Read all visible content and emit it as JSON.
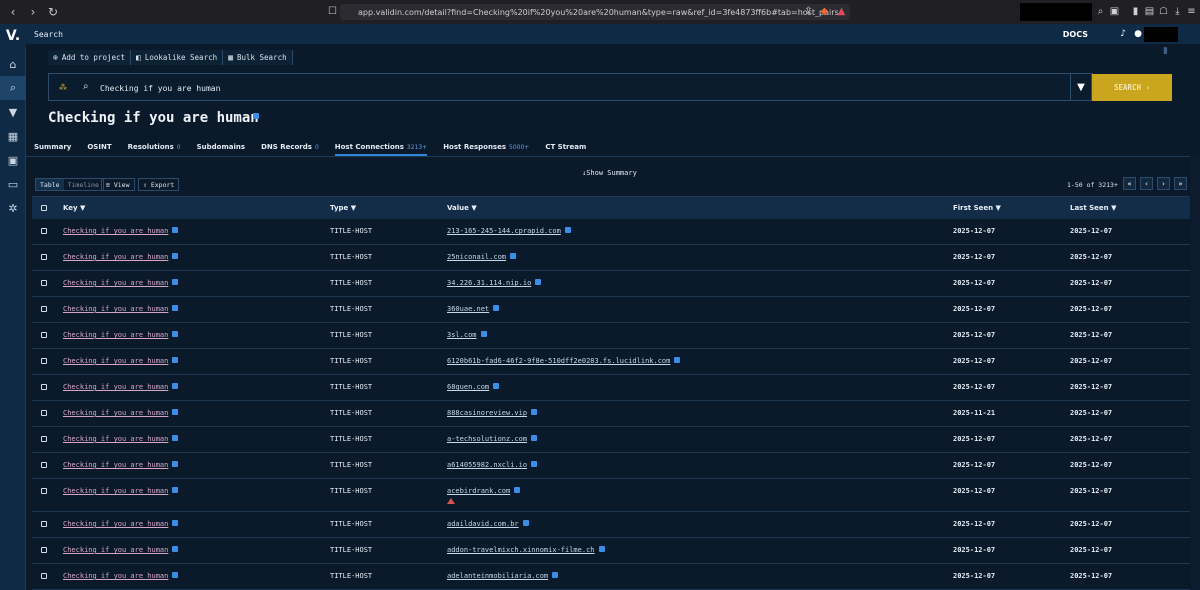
{
  "browser": {
    "url": "app.validin.com/detail?find=Checking%20if%20you%20are%20human&type=raw&ref_id=3fe4873ff6b#tab=host_pairs"
  },
  "app": {
    "logo": "V.",
    "section_title": "Search",
    "docs_label": "DOCS"
  },
  "toolbar": {
    "add_project": "Add to project",
    "lookalike": "Lookalike Search",
    "bulk": "Bulk Search"
  },
  "search": {
    "query": "Checking if you are human",
    "button_label": "SEARCH ›"
  },
  "page_title": "Checking if you are human",
  "tabs": [
    {
      "label": "Summary",
      "badge": ""
    },
    {
      "label": "OSINT",
      "badge": ""
    },
    {
      "label": "Resolutions",
      "badge": "0"
    },
    {
      "label": "Subdomains",
      "badge": ""
    },
    {
      "label": "DNS Records",
      "badge": "0"
    },
    {
      "label": "Host Connections",
      "badge": "3213+"
    },
    {
      "label": "Host Responses",
      "badge": "5000+"
    },
    {
      "label": "CT Stream",
      "badge": ""
    }
  ],
  "summary_toggle": "↓Show Summary",
  "controls": {
    "table": "Table",
    "timeline": "Timeline",
    "view": "View",
    "export": "Export",
    "pagination": "1-50 of 3213+"
  },
  "table": {
    "headers": {
      "key": "Key",
      "type": "Type",
      "value": "Value",
      "first_seen": "First Seen",
      "last_seen": "Last Seen"
    },
    "rows": [
      {
        "key": "Checking if you are human",
        "type": "TITLE-HOST",
        "value": "213-165-245-144.cprapid.com",
        "first": "2025-12-07",
        "last": "2025-12-07"
      },
      {
        "key": "Checking if you are human",
        "type": "TITLE-HOST",
        "value": "25niconail.com",
        "first": "2025-12-07",
        "last": "2025-12-07"
      },
      {
        "key": "Checking if you are human",
        "type": "TITLE-HOST",
        "value": "34.226.31.114.nip.io",
        "first": "2025-12-07",
        "last": "2025-12-07"
      },
      {
        "key": "Checking if you are human",
        "type": "TITLE-HOST",
        "value": "360uae.net",
        "first": "2025-12-07",
        "last": "2025-12-07"
      },
      {
        "key": "Checking if you are human",
        "type": "TITLE-HOST",
        "value": "3sl.com",
        "first": "2025-12-07",
        "last": "2025-12-07"
      },
      {
        "key": "Checking if you are human",
        "type": "TITLE-HOST",
        "value": "6120b61b-fad6-46f2-9f8e-510dff2e0283.fs.lucidlink.com",
        "first": "2025-12-07",
        "last": "2025-12-07"
      },
      {
        "key": "Checking if you are human",
        "type": "TITLE-HOST",
        "value": "68quen.com",
        "first": "2025-12-07",
        "last": "2025-12-07"
      },
      {
        "key": "Checking if you are human",
        "type": "TITLE-HOST",
        "value": "888casinoreview.vip",
        "first": "2025-11-21",
        "last": "2025-12-07"
      },
      {
        "key": "Checking if you are human",
        "type": "TITLE-HOST",
        "value": "a-techsolutionz.com",
        "first": "2025-12-07",
        "last": "2025-12-07"
      },
      {
        "key": "Checking if you are human",
        "type": "TITLE-HOST",
        "value": "a614055982.nxcli.io",
        "first": "2025-12-07",
        "last": "2025-12-07"
      },
      {
        "key": "Checking if you are human",
        "type": "TITLE-HOST",
        "value": "acebirdrank.com",
        "first": "2025-12-07",
        "last": "2025-12-07",
        "warning": true
      },
      {
        "key": "Checking if you are human",
        "type": "TITLE-HOST",
        "value": "adaildavid.com.br",
        "first": "2025-12-07",
        "last": "2025-12-07"
      },
      {
        "key": "Checking if you are human",
        "type": "TITLE-HOST",
        "value": "addon-travelmixch.xinnomix-filme.ch",
        "first": "2025-12-07",
        "last": "2025-12-07"
      },
      {
        "key": "Checking if you are human",
        "type": "TITLE-HOST",
        "value": "adelanteinmobiliaria.com",
        "first": "2025-12-07",
        "last": "2025-12-07"
      }
    ]
  },
  "colors": {
    "background": "#0b1a2b",
    "sidebar": "#0f2a45",
    "accent": "#c9a61e",
    "link_key": "#d7a6c4",
    "warning": "#d9534f"
  }
}
